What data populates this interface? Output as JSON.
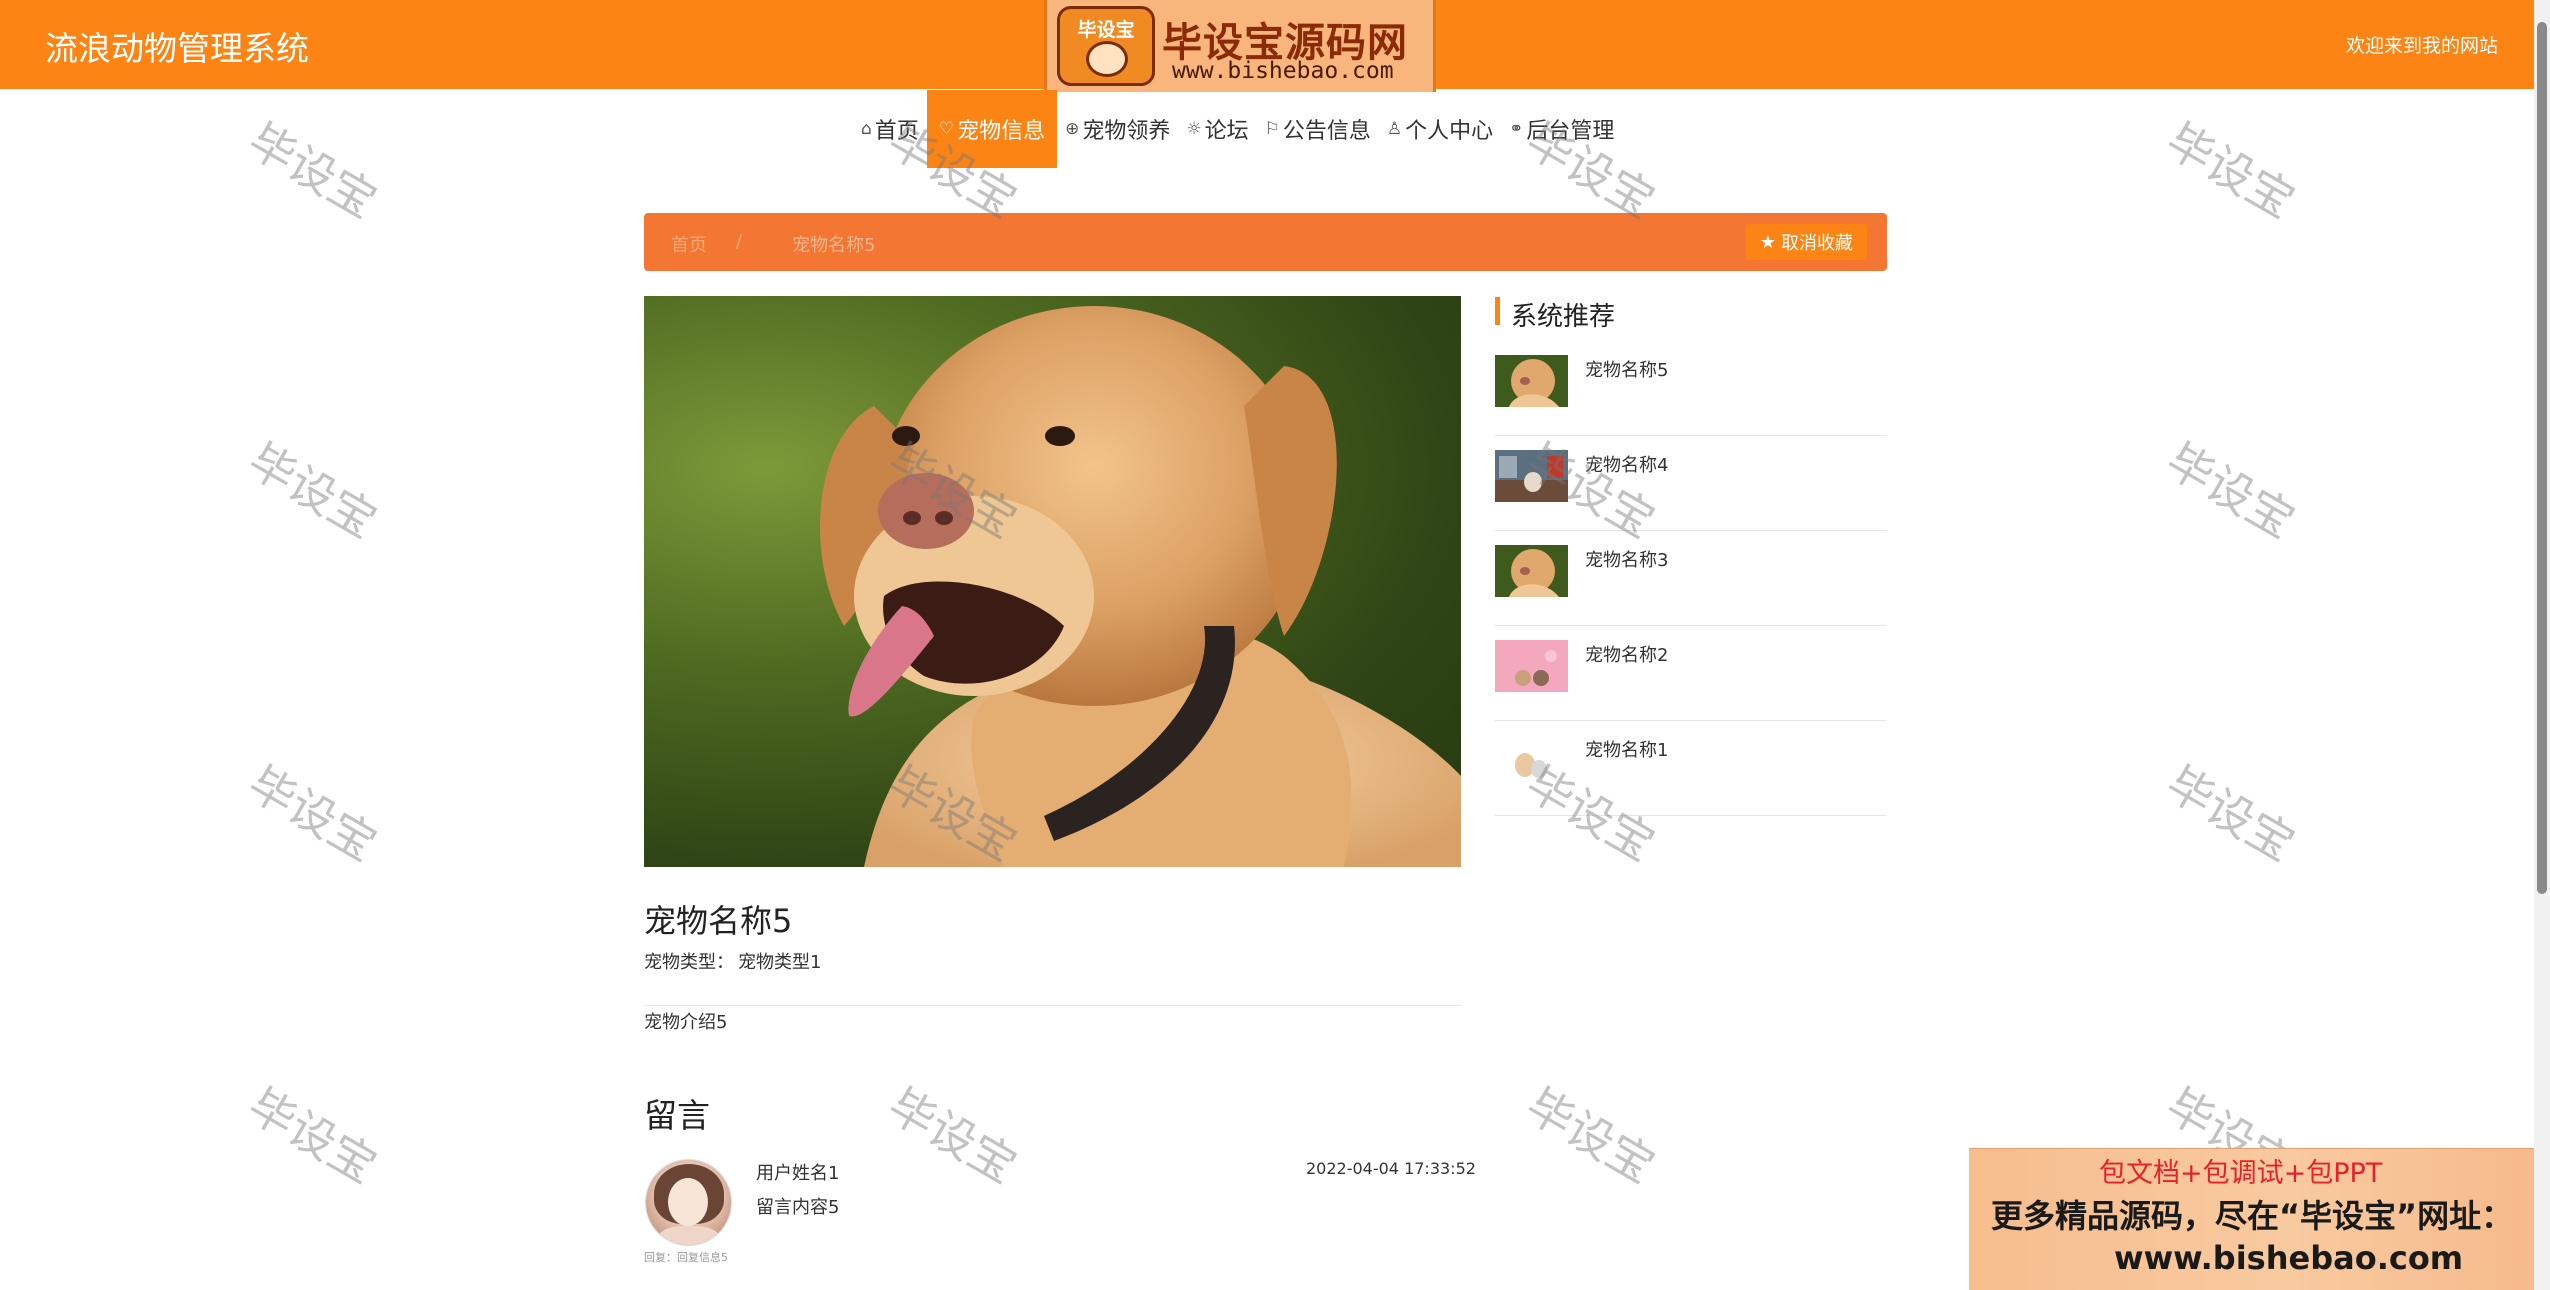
{
  "header": {
    "site_title": "流浪动物管理系统",
    "welcome": "欢迎来到我的网站",
    "logo": {
      "badge_text": "毕设宝",
      "name": "毕设宝源码网",
      "url": "www.bishebao.com"
    }
  },
  "nav": {
    "items": [
      {
        "label": "首页",
        "icon": "home-icon",
        "glyph": "⌂"
      },
      {
        "label": "宠物信息",
        "icon": "pet-icon",
        "glyph": "♡"
      },
      {
        "label": "宠物领养",
        "icon": "globe-icon",
        "glyph": "⊕"
      },
      {
        "label": "论坛",
        "icon": "gear-icon",
        "glyph": "☼"
      },
      {
        "label": "公告信息",
        "icon": "flag-icon",
        "glyph": "⚐"
      },
      {
        "label": "个人中心",
        "icon": "user-icon",
        "glyph": "♙"
      },
      {
        "label": "后台管理",
        "icon": "link-icon",
        "glyph": "⚭"
      }
    ],
    "active_index": 1
  },
  "breadcrumb": {
    "home": "首页",
    "separator": "/",
    "current": "宠物名称5"
  },
  "favorite_button": {
    "label": "取消收藏",
    "icon": "star-icon"
  },
  "detail": {
    "title": "宠物名称5",
    "type_label": "宠物类型：",
    "type_value": "宠物类型1",
    "intro": "宠物介绍5"
  },
  "messages": {
    "heading": "留言",
    "items": [
      {
        "user": "用户姓名1",
        "content": "留言内容5",
        "time": "2022-04-04 17:33:52",
        "reply": "回复：回复信息5"
      }
    ]
  },
  "sidebar": {
    "heading": "系统推荐",
    "items": [
      {
        "label": "宠物名称5",
        "thumb": "dog"
      },
      {
        "label": "宠物名称4",
        "thumb": "cat-dog-room"
      },
      {
        "label": "宠物名称3",
        "thumb": "dog"
      },
      {
        "label": "宠物名称2",
        "thumb": "pink-pets"
      },
      {
        "label": "宠物名称1",
        "thumb": "white-pets"
      }
    ]
  },
  "watermark_text": "毕设宝",
  "ad_banner": {
    "line1": "包文档+包调试+包PPT",
    "line2": "更多精品源码，尽在“毕设宝”网址：",
    "line3": "www.bishebao.com"
  },
  "colors": {
    "brand_orange": "#fb8414",
    "breadcrumb_bg": "#f37632",
    "ad_red": "#e8202a"
  }
}
